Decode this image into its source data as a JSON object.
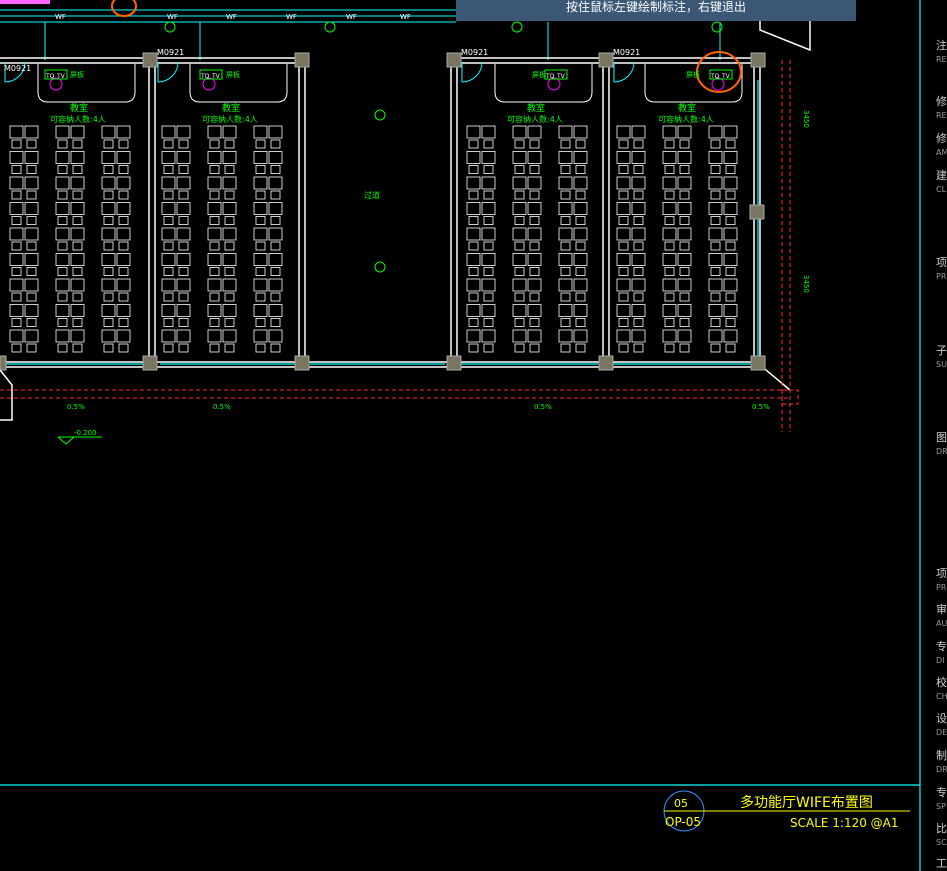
{
  "hint": "按住鼠标左键绘制标注，右键退出",
  "drawing": {
    "door_labels": [
      "M0921",
      "M0921",
      "M0921",
      "M0921"
    ],
    "room_name": "教室",
    "room_capacity": "可容纳人数:4人",
    "corridor_label": "过道",
    "device_labels": {
      "tq": "TQ",
      "tv": "TV",
      "screen": "屏板"
    },
    "slope": "0.5%",
    "elevation": "-0.200",
    "wifi_symbol": "WF",
    "dims": [
      "3450",
      "3450"
    ]
  },
  "title_block": {
    "number": "05",
    "sheet": "OP-05",
    "title": "多功能厅WIFE布置图",
    "scale": "SCALE 1:120  @A1"
  },
  "right_panel": [
    {
      "cn": "注",
      "en": "RE"
    },
    {
      "cn": "修",
      "en": "RE"
    },
    {
      "cn": "修",
      "en": "AM"
    },
    {
      "cn": "建",
      "en": "CL"
    },
    {
      "cn": "项",
      "en": "PR"
    },
    {
      "cn": "子",
      "en": "SU"
    },
    {
      "cn": "图",
      "en": "DR"
    },
    {
      "cn": "项",
      "en": "PR"
    },
    {
      "cn": "审",
      "en": "AU"
    },
    {
      "cn": "专",
      "en": "DI"
    },
    {
      "cn": "校",
      "en": "CH"
    },
    {
      "cn": "设",
      "en": "DE"
    },
    {
      "cn": "制",
      "en": "DR"
    },
    {
      "cn": "专",
      "en": "SP"
    },
    {
      "cn": "比",
      "en": "SC"
    },
    {
      "cn": "工",
      "en": ""
    }
  ],
  "colors": {
    "wall": "#ffffff",
    "annot": "#00ff00",
    "glass": "#00ffff",
    "dash": "#ff3333",
    "title": "#ffff00",
    "mark": "#ff6600"
  }
}
